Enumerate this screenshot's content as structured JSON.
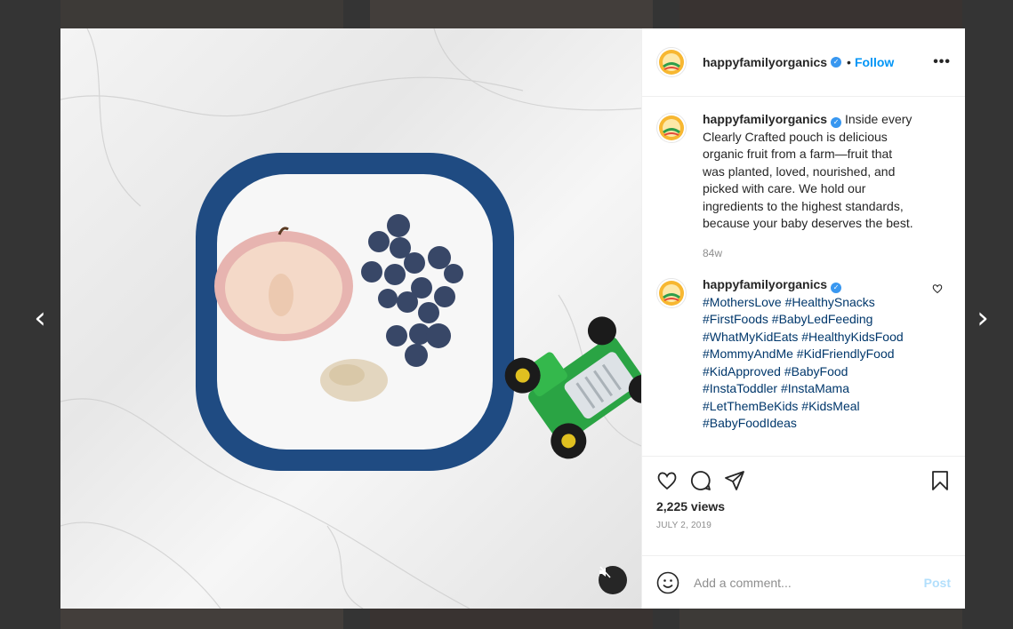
{
  "nav": {
    "prev_glyph": "‹",
    "next_glyph": "›"
  },
  "header": {
    "username": "happyfamilyorganics",
    "separator": "•",
    "follow_label": "Follow",
    "more_label": "•••"
  },
  "comments": [
    {
      "username": "happyfamilyorganics",
      "text": "Inside every Clearly Crafted pouch is delicious organic fruit from a farm—fruit that was planted, loved, nourished, and picked with care. We hold our ingredients to the highest standards, because your baby deserves the best.",
      "time": "84w"
    },
    {
      "username": "happyfamilyorganics",
      "hashtags": "#MothersLove #HealthySnacks #FirstFoods #BabyLedFeeding #WhatMyKidEats #HealthyKidsFood #MommyAndMe #KidFriendlyFood #KidApproved #BabyFood #InstaToddler #InstaMama #LetThemBeKids #KidsMeal #BabyFoodIdeas"
    }
  ],
  "stats": {
    "views": "2,225 views",
    "date": "JULY 2, 2019"
  },
  "composer": {
    "placeholder": "Add a comment...",
    "post_label": "Post"
  },
  "icons": {
    "like": "heart-icon",
    "comment": "comment-bubble-icon",
    "share": "paper-plane-icon",
    "save": "bookmark-icon",
    "emoji": "smiley-icon",
    "mute": "speaker-muted-icon",
    "verified": "verified-badge-icon",
    "brand_accent": "#3897f0",
    "follow_color": "#0095f6"
  }
}
